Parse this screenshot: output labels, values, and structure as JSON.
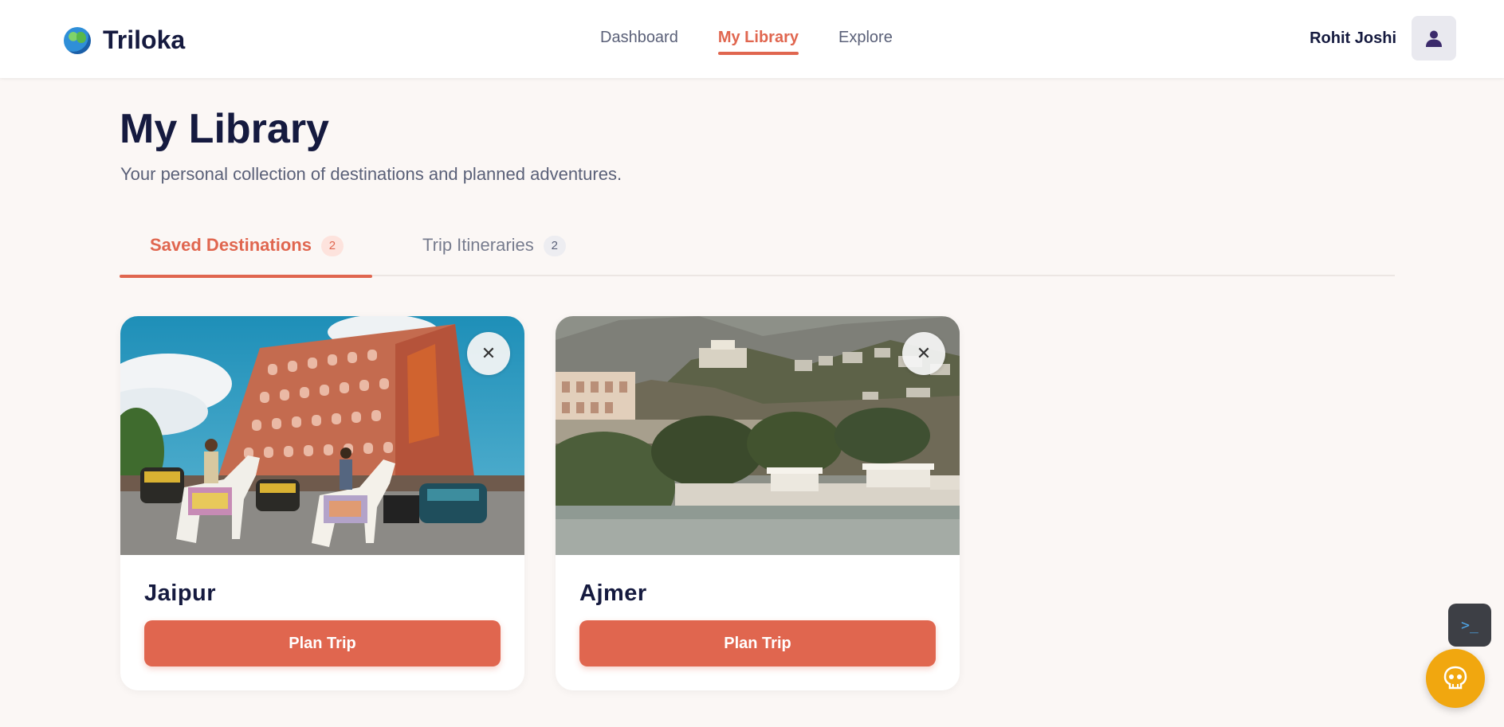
{
  "header": {
    "brand": "Triloka",
    "nav": [
      {
        "label": "Dashboard"
      },
      {
        "label": "My Library"
      },
      {
        "label": "Explore"
      }
    ],
    "user_name": "Rohit Joshi"
  },
  "page": {
    "title": "My Library",
    "subtitle": "Your personal collection of destinations and planned adventures."
  },
  "tabs": [
    {
      "label": "Saved Destinations",
      "count": "2"
    },
    {
      "label": "Trip Itineraries",
      "count": "2"
    }
  ],
  "cards": [
    {
      "title": "Jaipur",
      "button": "Plan Trip",
      "close": "✕"
    },
    {
      "title": "Ajmer",
      "button": "Plan Trip",
      "close": "✕"
    }
  ],
  "floating": {
    "terminal_glyph": ">_"
  },
  "colors": {
    "accent": "#e0664f",
    "navy": "#151a3f",
    "background": "#fbf7f5",
    "fab": "#f1a70f"
  },
  "icons": [
    "globe-icon",
    "user-avatar-icon",
    "close-icon",
    "terminal-icon",
    "skull-bot-icon"
  ]
}
